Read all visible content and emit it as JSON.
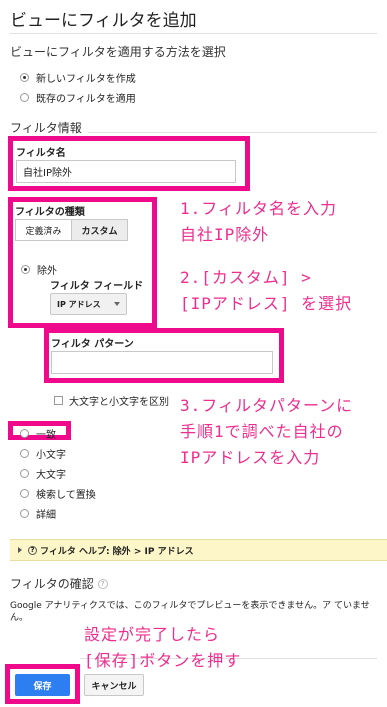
{
  "page": {
    "title": "ビューにフィルタを追加"
  },
  "method": {
    "heading": "ビューにフィルタを適用する方法を選択",
    "options": [
      "新しいフィルタを作成",
      "既存のフィルタを適用"
    ]
  },
  "filter_info": {
    "heading": "フィルタ情報",
    "name_label": "フィルタ名",
    "name_value": "自社IP除外",
    "type_label": "フィルタの種類",
    "tabs": [
      "定義済み",
      "カスタム"
    ],
    "exclude_label": "除外",
    "field_label": "フィルタ フィールド",
    "field_value": "IP アドレス",
    "pattern_label": "フィルタ パターン",
    "pattern_value": "",
    "case_label": "大文字と小文字を区別",
    "match_options": [
      "一致",
      "小文字",
      "大文字",
      "検索して置換",
      "詳細"
    ]
  },
  "help": {
    "text": "フィルタ ヘルプ: 除外 > IP アドレス"
  },
  "verify": {
    "heading": "フィルタの確認",
    "message": "Google アナリティクスでは、このフィルタでプレビューを表示できません。ア ていません。"
  },
  "buttons": {
    "save": "保存",
    "cancel": "キャンセル"
  },
  "annotations": {
    "step1_line1": "1.フィルタ名を入力",
    "step1_line2": "自社IP除外",
    "step2_line1": "2.[カスタム] >",
    "step2_line2": "[IPアドレス] を選択",
    "step3_line1": "3.フィルタパターンに",
    "step3_line2": "手順1で調べた自社の",
    "step3_line3": "IPアドレスを入力",
    "step4_line1": "設定が完了したら",
    "step4_line2": "[保存]ボタンを押す"
  },
  "colors": {
    "annotation_pink": "#ee0a8b",
    "save_button": "#2d7ef1",
    "help_bar": "#fdf6c8"
  }
}
